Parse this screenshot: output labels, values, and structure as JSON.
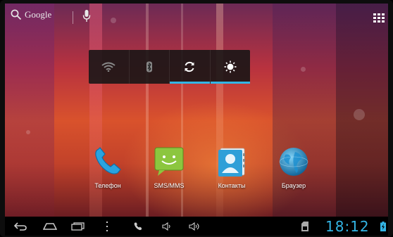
{
  "search": {
    "label": "Google"
  },
  "power_widget": {
    "buttons": [
      {
        "id": "wifi",
        "icon": "wifi-icon",
        "active": false
      },
      {
        "id": "bluetooth",
        "icon": "bluetooth-icon",
        "active": false
      },
      {
        "id": "sync",
        "icon": "sync-icon",
        "active": true
      },
      {
        "id": "brightness",
        "icon": "brightness-icon",
        "active": true
      }
    ],
    "accent": "#33b5e5"
  },
  "shortcuts": [
    {
      "label": "Телефон",
      "icon": "phone-icon"
    },
    {
      "label": "SMS/MMS",
      "icon": "sms-icon"
    },
    {
      "label": "Контакты",
      "icon": "contacts-icon"
    },
    {
      "label": "Браузер",
      "icon": "browser-globe-icon"
    }
  ],
  "status_bar": {
    "time": "18:12",
    "clock_color": "#33b5e5"
  }
}
